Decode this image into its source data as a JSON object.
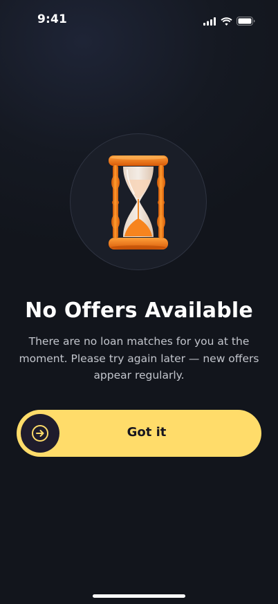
{
  "status_bar": {
    "time": "9:41",
    "icons": [
      "cellular-signal-icon",
      "wifi-icon",
      "battery-icon"
    ]
  },
  "illustration": {
    "icon": "hourglass-icon"
  },
  "empty_state": {
    "title": "No Offers Available",
    "message": "There are no loan matches for you at the moment. Please try again later — new offers appear regularly."
  },
  "cta": {
    "label": "Got it",
    "icon": "arrow-right-circle-icon"
  },
  "colors": {
    "accent": "#FFDC6A",
    "background": "#12151C",
    "hourglass": "#F97E16"
  }
}
